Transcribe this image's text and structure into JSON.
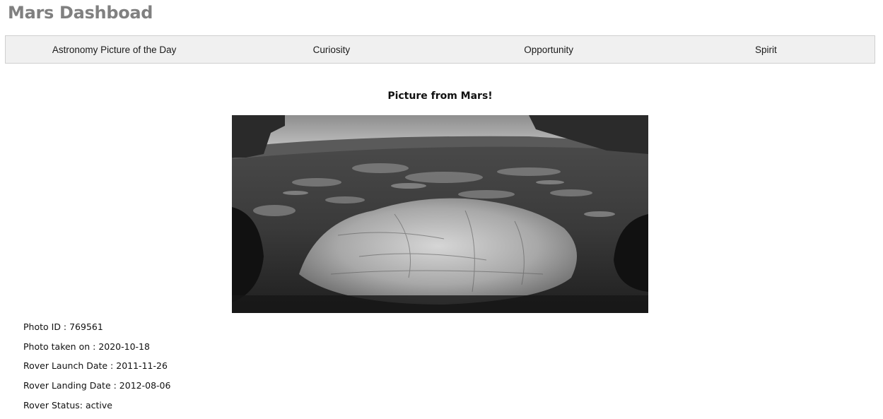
{
  "app": {
    "title": "Mars Dashboad"
  },
  "nav": {
    "items": [
      {
        "label": "Astronomy Picture of the Day"
      },
      {
        "label": "Curiosity"
      },
      {
        "label": "Opportunity"
      },
      {
        "label": "Spirit"
      }
    ]
  },
  "main": {
    "heading": "Picture from Mars!",
    "photo_alt": "Mars surface photo taken by rover"
  },
  "details": {
    "photo_id": {
      "label": "Photo ID : ",
      "value": "769561"
    },
    "photo_taken": {
      "label": "Photo taken on : ",
      "value": "2020-10-18"
    },
    "launch_date": {
      "label": "Rover Launch Date : ",
      "value": "2011-11-26"
    },
    "landing_date": {
      "label": "Rover Landing Date : ",
      "value": "2012-08-06"
    },
    "status": {
      "label": "Rover Status: ",
      "value": "active"
    }
  }
}
